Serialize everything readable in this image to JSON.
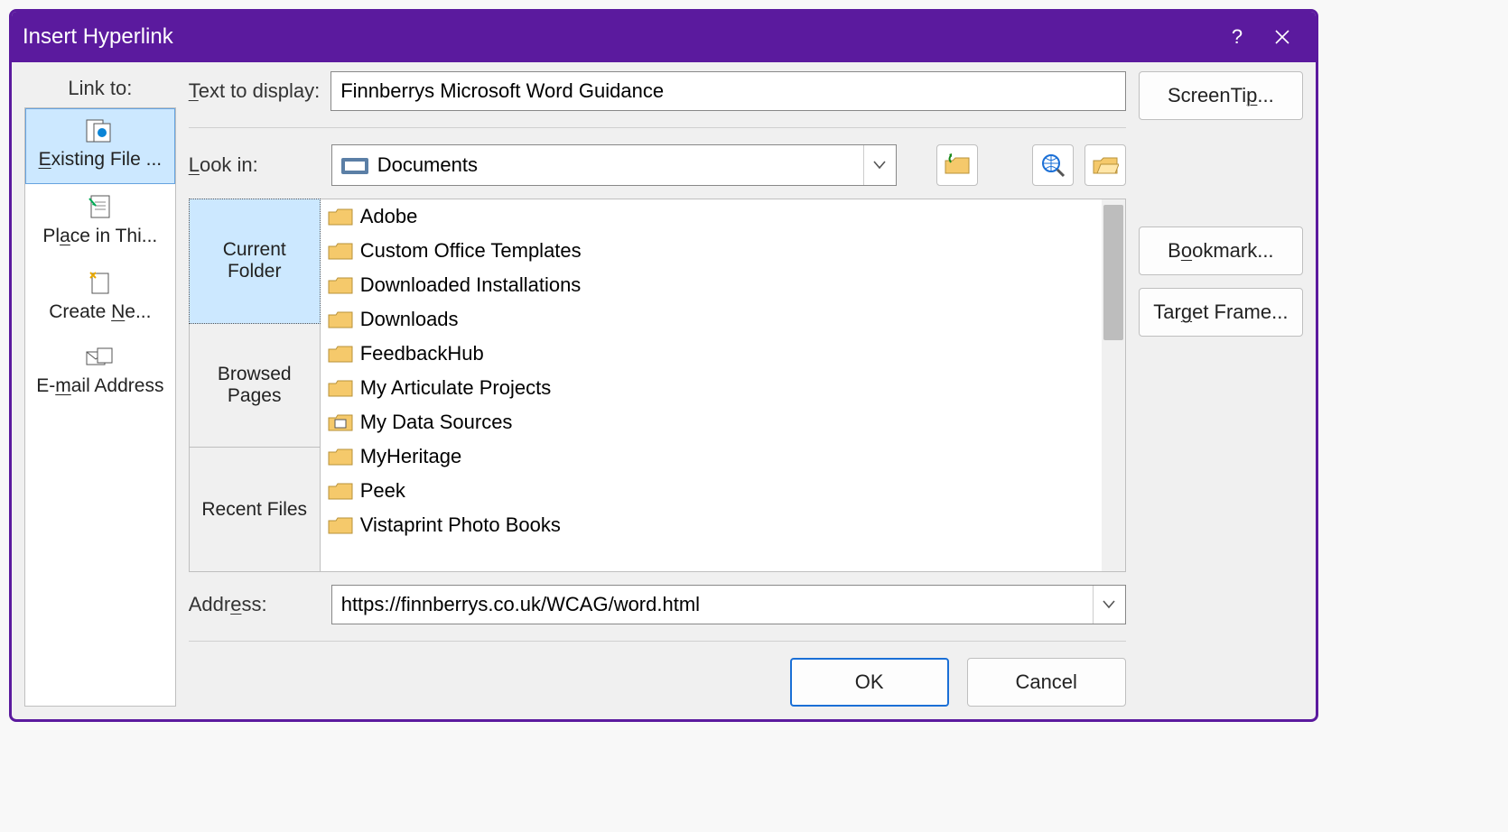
{
  "title": "Insert Hyperlink",
  "linkto_label": "Link to:",
  "linkto_items": [
    {
      "label": "Existing File ..."
    },
    {
      "label": "Place in Thi..."
    },
    {
      "label": "Create Ne..."
    },
    {
      "label": "E-mail Address"
    }
  ],
  "text_to_display_label": "Text to display:",
  "text_to_display_value": "Finnberrys Microsoft Word Guidance",
  "screentip_label": "ScreenTip...",
  "lookin_label": "Look in:",
  "lookin_value": "Documents",
  "tabs": [
    {
      "label": "Current Folder"
    },
    {
      "label": "Browsed Pages"
    },
    {
      "label": "Recent Files"
    }
  ],
  "folders": [
    "Adobe",
    "Custom Office Templates",
    "Downloaded Installations",
    "Downloads",
    "FeedbackHub",
    "My Articulate Projects",
    "My Data Sources",
    "MyHeritage",
    "Peek",
    "Vistaprint Photo Books"
  ],
  "bookmark_label": "Bookmark...",
  "targetframe_label": "Target Frame...",
  "address_label": "Address:",
  "address_value": "https://finnberrys.co.uk/WCAG/word.html",
  "ok_label": "OK",
  "cancel_label": "Cancel"
}
